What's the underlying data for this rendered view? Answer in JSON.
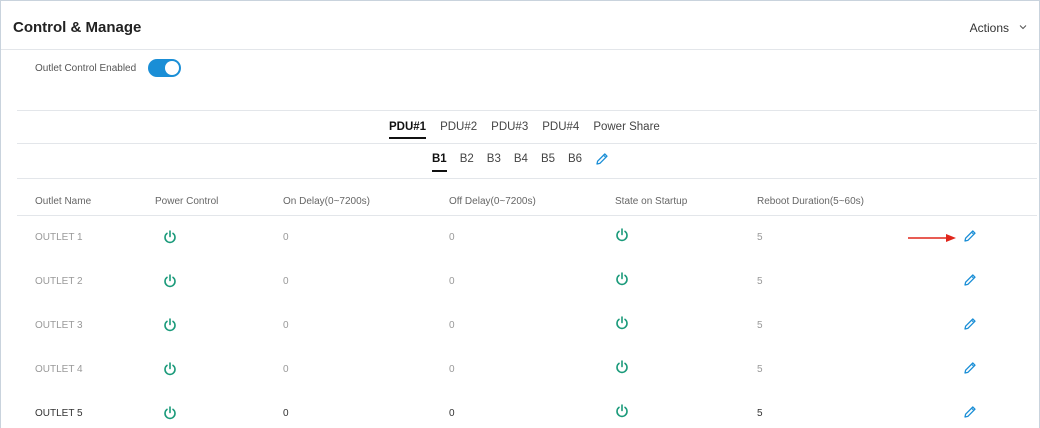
{
  "header": {
    "title": "Control & Manage",
    "actions_label": "Actions"
  },
  "outlet_control": {
    "label": "Outlet Control Enabled",
    "enabled": true
  },
  "pdu_tabs": [
    {
      "label": "PDU#1",
      "active": true
    },
    {
      "label": "PDU#2",
      "active": false
    },
    {
      "label": "PDU#3",
      "active": false
    },
    {
      "label": "PDU#4",
      "active": false
    },
    {
      "label": "Power Share",
      "active": false
    }
  ],
  "bank_tabs": [
    {
      "label": "B1",
      "active": true
    },
    {
      "label": "B2",
      "active": false
    },
    {
      "label": "B3",
      "active": false
    },
    {
      "label": "B4",
      "active": false
    },
    {
      "label": "B5",
      "active": false
    },
    {
      "label": "B6",
      "active": false
    }
  ],
  "table": {
    "columns": [
      "Outlet Name",
      "Power Control",
      "On Delay(0~7200s)",
      "Off Delay(0~7200s)",
      "State on Startup",
      "Reboot Duration(5~60s)"
    ],
    "rows": [
      {
        "name": "OUTLET 1",
        "on_delay": "0",
        "off_delay": "0",
        "reboot": "5"
      },
      {
        "name": "OUTLET 2",
        "on_delay": "0",
        "off_delay": "0",
        "reboot": "5"
      },
      {
        "name": "OUTLET 3",
        "on_delay": "0",
        "off_delay": "0",
        "reboot": "5"
      },
      {
        "name": "OUTLET 4",
        "on_delay": "0",
        "off_delay": "0",
        "reboot": "5"
      },
      {
        "name": "OUTLET 5",
        "on_delay": "0",
        "off_delay": "0",
        "reboot": "5"
      }
    ]
  },
  "colors": {
    "accent_blue": "#1a8ed6",
    "power_green": "#1a9a7a",
    "arrow_red": "#e0261c"
  },
  "icons": {
    "power": "power-icon",
    "edit": "pencil-icon",
    "chevron": "chevron-down-icon"
  }
}
